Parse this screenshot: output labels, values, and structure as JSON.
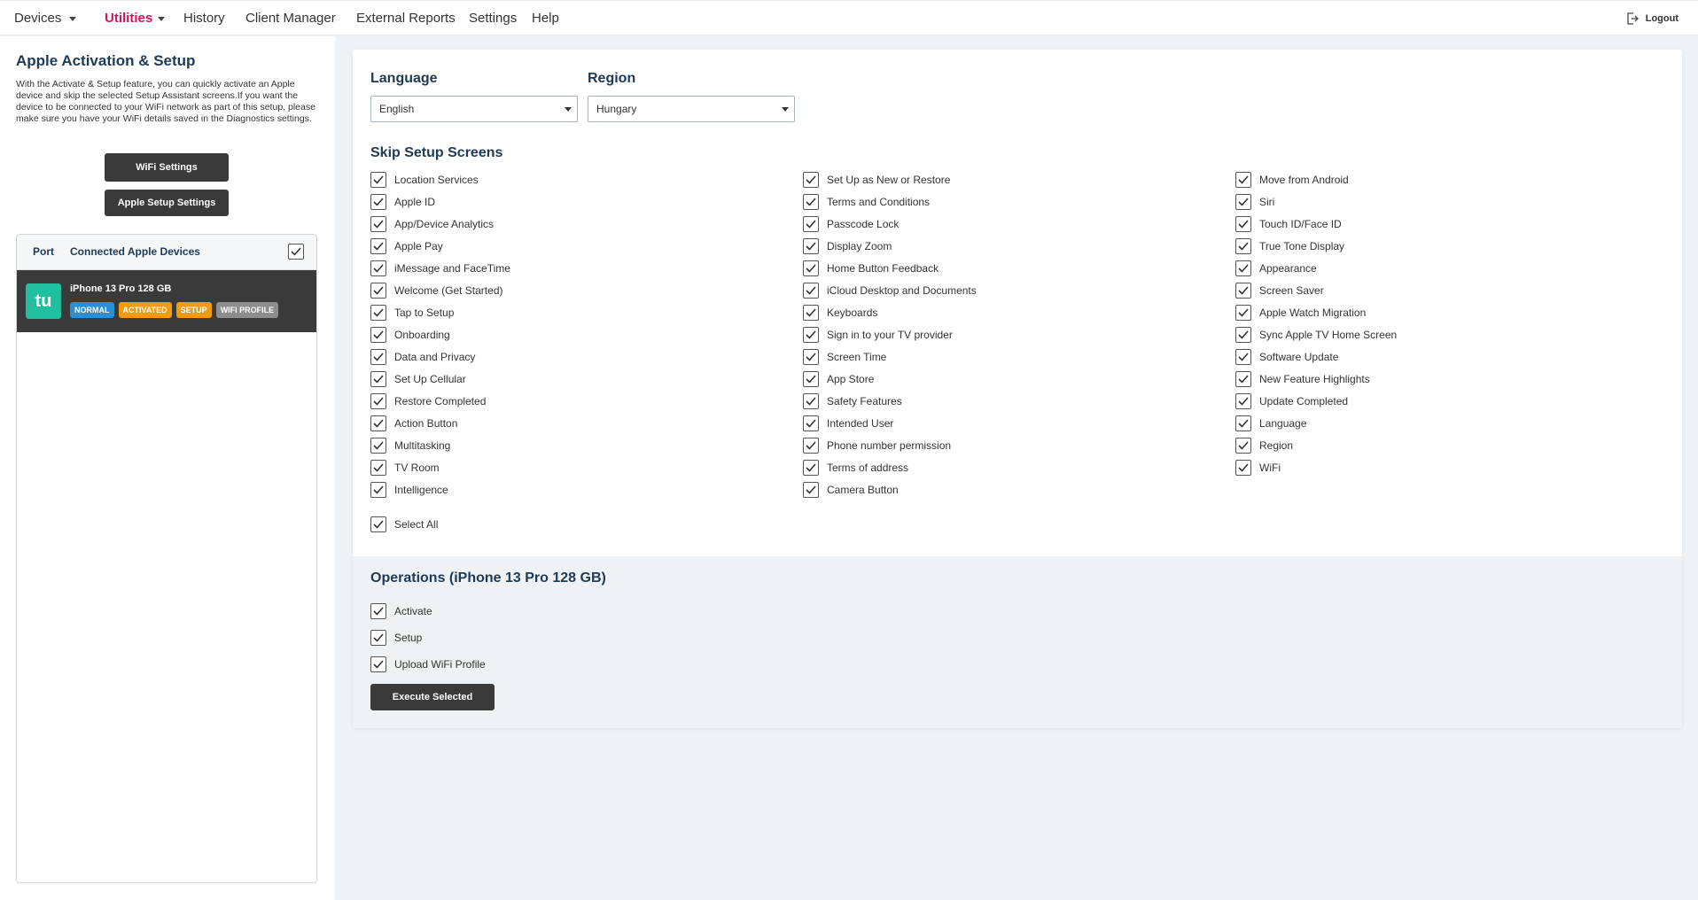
{
  "nav": {
    "devices": "Devices",
    "utilities": "Utilities",
    "history": "History",
    "client_manager": "Client Manager",
    "external_reports": "External Reports",
    "settings": "Settings",
    "help": "Help",
    "logout": "Logout"
  },
  "sidebar": {
    "title": "Apple Activation & Setup",
    "description": "With the Activate & Setup feature, you can quickly activate an Apple device and skip the selected Setup Assistant screens.If you want the device to be connected to your WiFi network as part of this setup, please make sure you have your WiFi details saved in the Diagnostics settings.",
    "wifi_button": "WiFi Settings",
    "apple_setup_button": "Apple Setup Settings",
    "panel": {
      "port_header": "Port",
      "devices_header": "Connected Apple Devices",
      "device": {
        "avatar": "tu",
        "name": "iPhone 13 Pro 128 GB",
        "badges": [
          {
            "label": "NORMAL",
            "color": "#2b8fd6"
          },
          {
            "label": "ACTIVATED",
            "color": "#f59a0c"
          },
          {
            "label": "SETUP",
            "color": "#f59a0c"
          },
          {
            "label": "WIFI PROFILE",
            "color": "#8d8d8d"
          }
        ]
      }
    }
  },
  "main": {
    "language_label": "Language",
    "language_value": "English",
    "region_label": "Region",
    "region_value": "Hungary",
    "skip_title": "Skip Setup Screens",
    "columns": [
      [
        "Location Services",
        "Apple ID",
        "App/Device Analytics",
        "Apple Pay",
        "iMessage and FaceTime",
        "Welcome (Get Started)",
        "Tap to Setup",
        "Onboarding",
        "Data and Privacy",
        "Set Up Cellular",
        "Restore Completed",
        "Action Button",
        "Multitasking",
        "TV Room",
        "Intelligence"
      ],
      [
        "Set Up as New or Restore",
        "Terms and Conditions",
        "Passcode Lock",
        "Display Zoom",
        "Home Button Feedback",
        "iCloud Desktop and Documents",
        "Keyboards",
        "Sign in to your TV provider",
        "Screen Time",
        "App Store",
        "Safety Features",
        "Intended User",
        "Phone number permission",
        "Terms of address",
        "Camera Button"
      ],
      [
        "Move from Android",
        "Siri",
        "Touch ID/Face ID",
        "True Tone Display",
        "Appearance",
        "Screen Saver",
        "Apple Watch Migration",
        "Sync Apple TV Home Screen",
        "Software Update",
        "New Feature Highlights",
        "Update Completed",
        "Language",
        "Region",
        "WiFi"
      ]
    ],
    "select_all": "Select All",
    "operations_title": "Operations (iPhone 13 Pro 128 GB)",
    "operations": [
      "Activate",
      "Setup",
      "Upload WiFi Profile"
    ],
    "execute_button": "Execute Selected"
  },
  "colors": {
    "accent": "#d4145a",
    "heading": "#1e3a56",
    "dark_button": "#3a3a3a",
    "avatar": "#1fbf9f"
  },
  "icons": {
    "nav_caret": "chevron-down-icon",
    "logout": "logout-icon",
    "checkbox": "checkmark-icon"
  }
}
